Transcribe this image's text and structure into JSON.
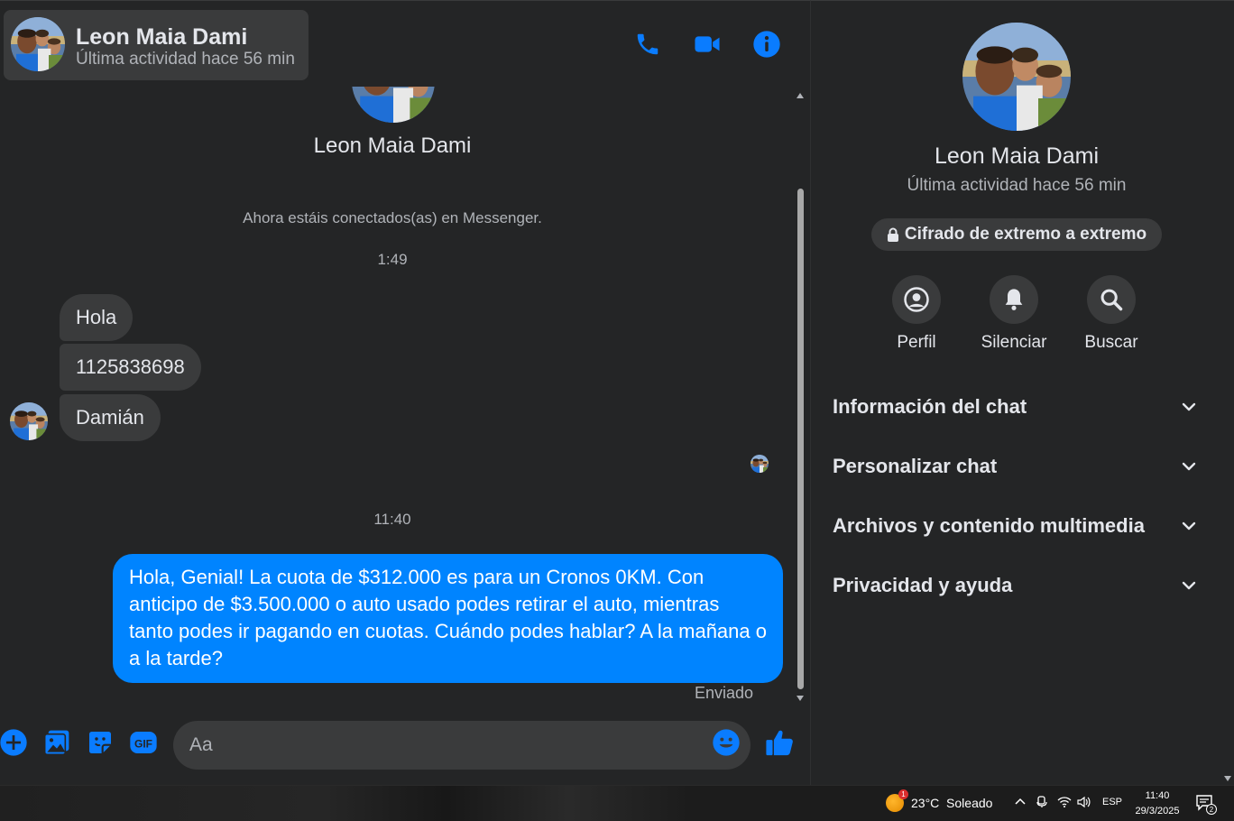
{
  "header": {
    "name": "Leon Maia Dami",
    "status": "Última actividad hace 56 min",
    "icons": [
      "phone-icon",
      "video-icon",
      "info-icon"
    ]
  },
  "conversation": {
    "contact_name": "Leon Maia Dami",
    "system_message": "Ahora estáis conectados(as) en Messenger.",
    "time_1": "1:49",
    "incoming": [
      "Hola",
      "1125838698",
      "Damián"
    ],
    "time_2": "11:40",
    "outgoing": "Hola, Genial! La cuota de $312.000 es para un Cronos 0KM. Con anticipo de $3.500.000 o auto usado podes retirar el auto, mientras tanto podes ir pagando en cuotas. Cuándo podes hablar? A la mañana o a la tarde?",
    "sent_label": "Enviado"
  },
  "composer": {
    "placeholder": "Aa",
    "icons": [
      "plus-icon",
      "image-icon",
      "sticker-icon",
      "gif-icon",
      "emoji-icon",
      "like-icon"
    ],
    "gif_label": "GIF"
  },
  "info_panel": {
    "name": "Leon Maia Dami",
    "status": "Última actividad hace 56 min",
    "encryption": "Cifrado de extremo a extremo",
    "actions": [
      {
        "label": "Perfil",
        "icon": "profile-icon"
      },
      {
        "label": "Silenciar",
        "icon": "bell-icon"
      },
      {
        "label": "Buscar",
        "icon": "search-icon"
      }
    ],
    "sections": [
      "Información del chat",
      "Personalizar chat",
      "Archivos y contenido multimedia",
      "Privacidad y ayuda"
    ]
  },
  "taskbar": {
    "weather": "23°C  Soleado",
    "weather_badge": "1",
    "language": "ESP",
    "time": "11:40",
    "date": "29/3/2025",
    "notifications": "2"
  },
  "colors": {
    "background": "#242526",
    "bubble_incoming": "#3a3b3c",
    "bubble_outgoing": "#0084ff",
    "accent": "#0a7cff"
  }
}
